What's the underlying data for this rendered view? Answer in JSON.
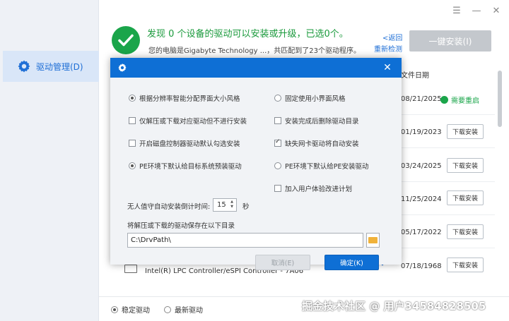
{
  "window": {
    "menu_glyph": "☰",
    "minimize_glyph": "—",
    "close_glyph": "✕"
  },
  "sidebar": {
    "items": [
      {
        "label": "驱动管理(D)",
        "icon": "gear-icon"
      }
    ]
  },
  "header": {
    "title": "发现 0 个设备的驱动可以安装或升级，已选0个。",
    "subtitle": "您的电脑是Gigabyte Technology ...，共匹配到了23个驱动程序。",
    "back_link": "<返回",
    "redetect_link": "重新检测",
    "install_all_label": "一键安装(I)"
  },
  "list": {
    "date_column_header": "文件日期",
    "rows": [
      {
        "date": "08/21/2025",
        "status": "需要重启",
        "button": ""
      },
      {
        "date": "01/19/2023",
        "status": "",
        "button": "下载安装"
      },
      {
        "date": "03/24/2025",
        "status": "",
        "button": "下载安装"
      },
      {
        "date": "11/25/2024",
        "status": "",
        "button": "下载安装"
      },
      {
        "date": "05/17/2022",
        "status": "",
        "button": "下载安装"
      },
      {
        "date": "07/18/1968",
        "status": "",
        "button": "下载安装"
      }
    ],
    "visible_device_name": "Intel(R) LPC Controller/eSPI Controller - 7A06"
  },
  "footer": {
    "radio_stable": "稳定驱动",
    "radio_latest": "最新驱动",
    "stable_selected": true,
    "watermark": "掘金技术社区 @ 用户34584828505"
  },
  "dialog": {
    "close_glyph": "✕",
    "options": {
      "adaptive_style": {
        "label": "根据分辨率智能分配界面大小风格",
        "checked": true
      },
      "fixed_small_style": {
        "label": "固定使用小界面风格",
        "checked": false
      },
      "extract_only": {
        "label": "仅解压或下载对应驱动但不进行安装",
        "checked": false
      },
      "delete_after_install": {
        "label": "安装完成后删除驱动目录",
        "checked": false
      },
      "default_disk_controller": {
        "label": "开启磁盘控制器驱动默认勾选安装",
        "checked": false
      },
      "auto_install_nic": {
        "label": "缺失网卡驱动将自动安装",
        "checked": true
      },
      "pe_target_system": {
        "label": "PE环境下默认给目标系统预装驱动",
        "checked": true
      },
      "pe_install_pe": {
        "label": "PE环境下默认给PE安装驱动",
        "checked": false
      },
      "user_experience": {
        "label": "加入用户体验改进计划",
        "checked": false
      }
    },
    "countdown_label": "无人值守自动安装倒计时间:",
    "countdown_value": "15",
    "countdown_unit": "秒",
    "path_label": "将解压或下载的驱动保存在以下目录",
    "path_value": "C:\\DrvPath\\",
    "cancel_label": "取消(E)",
    "ok_label": "确定(K)"
  },
  "colors": {
    "accent_blue": "#0e6fd5",
    "success_green": "#1aa54a"
  }
}
